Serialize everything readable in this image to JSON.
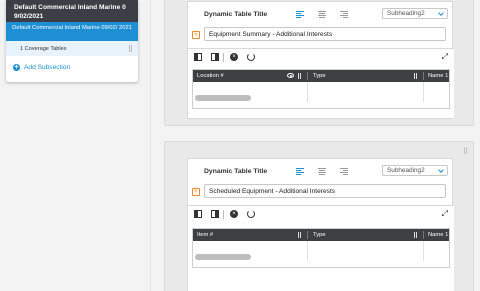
{
  "nav": {
    "title_line1": "Default Commercial Inland Marine 0",
    "title_line2": "9/02/2021",
    "subtitle": "Default Commercial Inland Marine 09/02/ 2021",
    "item_label": "1 Coverage Tables",
    "add_label": "Add Subsection"
  },
  "sections": [
    {
      "title_label": "Dynamic Table Title",
      "heading_select": "Subheading2",
      "title_value": "Equipment Summary - Additional Interests",
      "columns": [
        "Location #",
        "Type",
        "Name 1"
      ]
    },
    {
      "title_label": "Dynamic Table Title",
      "heading_select": "Subheading2",
      "title_value": "Scheduled Equipment - Additional Interests",
      "columns": [
        "Item #",
        "Type",
        "Name 1"
      ]
    }
  ],
  "icons": {
    "align_left": "align-left-icon",
    "align_center": "align-center-icon",
    "align_right": "align-right-icon",
    "edit": "edit-icon",
    "add_column_left": "column-left-icon",
    "add_column_right": "column-right-icon",
    "delete": "delete-icon",
    "refresh": "refresh-icon",
    "expand": "expand-icon"
  },
  "colors": {
    "accent": "#1e8fd5",
    "nav_header": "#3b3f45",
    "grid_header": "#3c4043",
    "edit_orange": "#f08a24"
  }
}
